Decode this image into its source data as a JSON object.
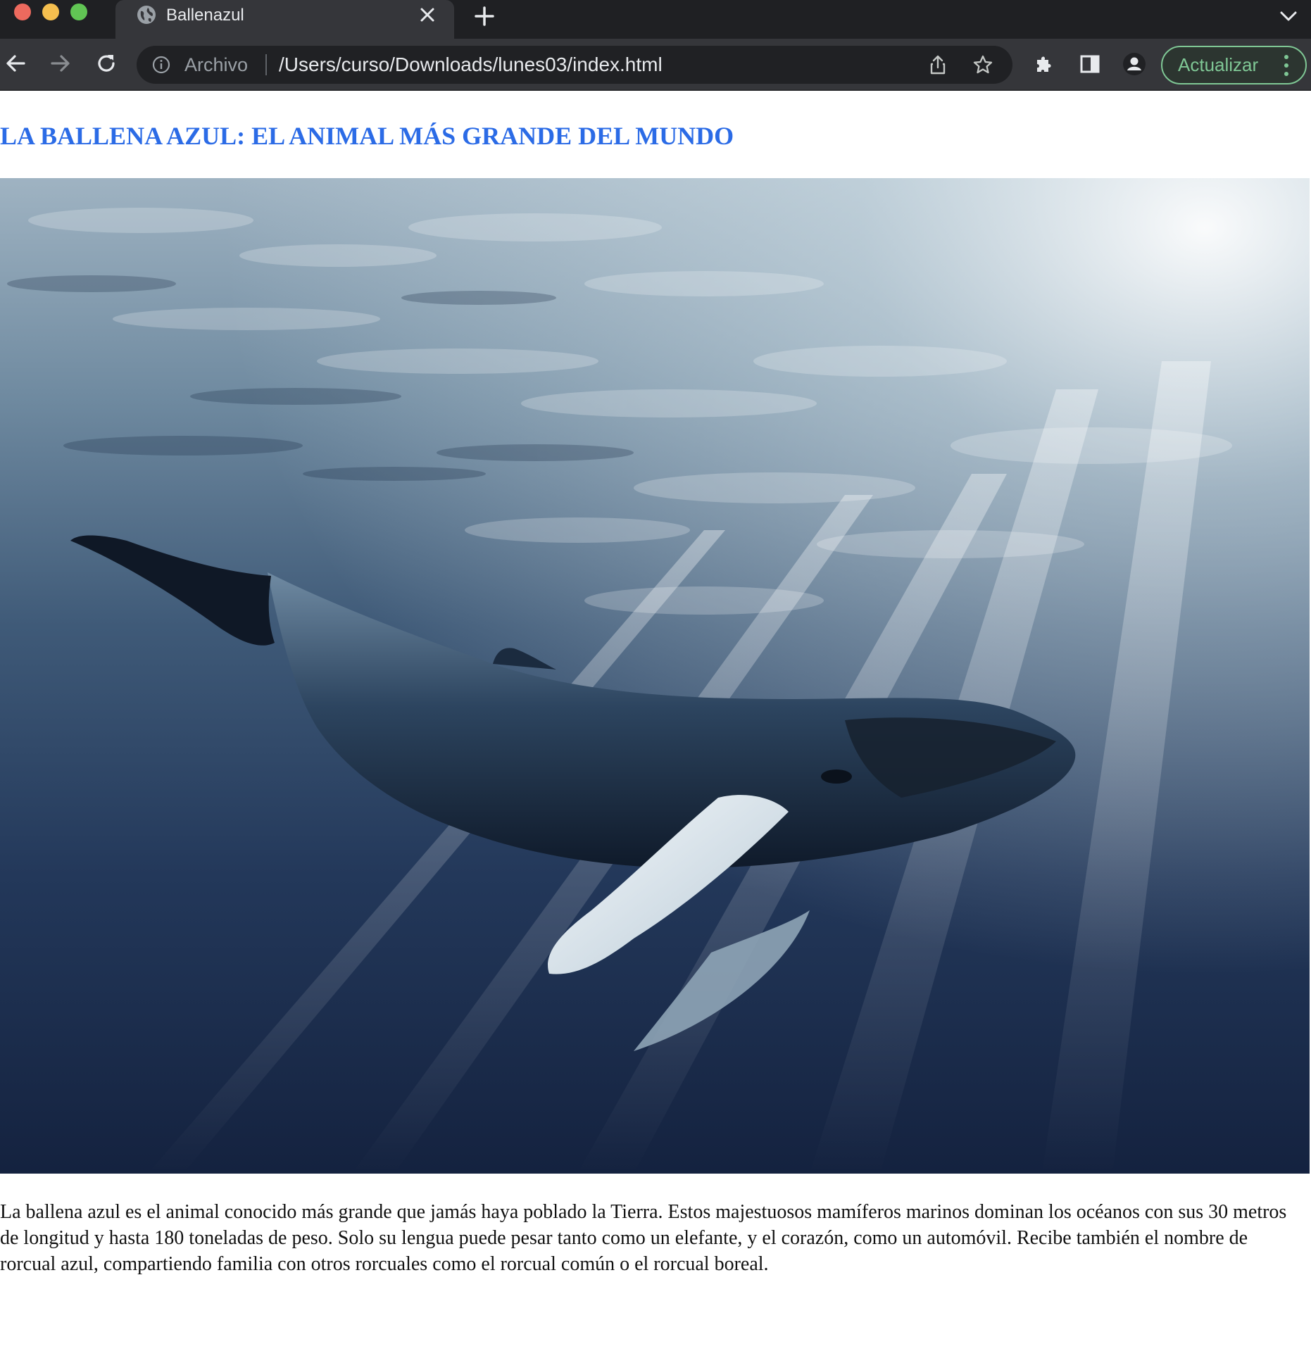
{
  "browser": {
    "tab": {
      "title": "Ballenazul"
    },
    "address_bar": {
      "security_label": "Archivo",
      "url": "/Users/curso/Downloads/lunes03/index.html"
    },
    "update_button_label": "Actualizar",
    "icons": {
      "tab_favicon": "globe-icon",
      "tab_close": "close-icon",
      "new_tab": "plus-icon",
      "tab_search": "chevron-down-icon",
      "back": "arrow-left-icon",
      "forward": "arrow-right-icon",
      "reload": "reload-icon",
      "site_info": "info-icon",
      "share": "share-icon",
      "bookmark": "star-icon",
      "extensions": "puzzle-icon",
      "side_panel": "side-panel-icon",
      "profile": "profile-icon",
      "menu": "kebab-menu-icon"
    },
    "colors": {
      "chrome_dark": "#1f2023",
      "toolbar": "#35363a",
      "update_accent": "#7fc795"
    }
  },
  "page": {
    "title": "LA BALLENA AZUL: EL ANIMAL MÁS GRANDE DEL MUNDO",
    "title_color": "#2b6be6",
    "paragraph": "La ballena azul es el animal conocido más grande que jamás haya poblado la Tierra. Estos majestuosos mamíferos marinos dominan los océanos con sus 30 metros de longitud y hasta 180 toneladas de peso. Solo su lengua puede pesar tanto como un elefante, y el corazón, como un automóvil. Recibe también el nombre de rorcual azul, compartiendo familia con otros rorcuales como el rorcual común o el rorcual boreal."
  }
}
